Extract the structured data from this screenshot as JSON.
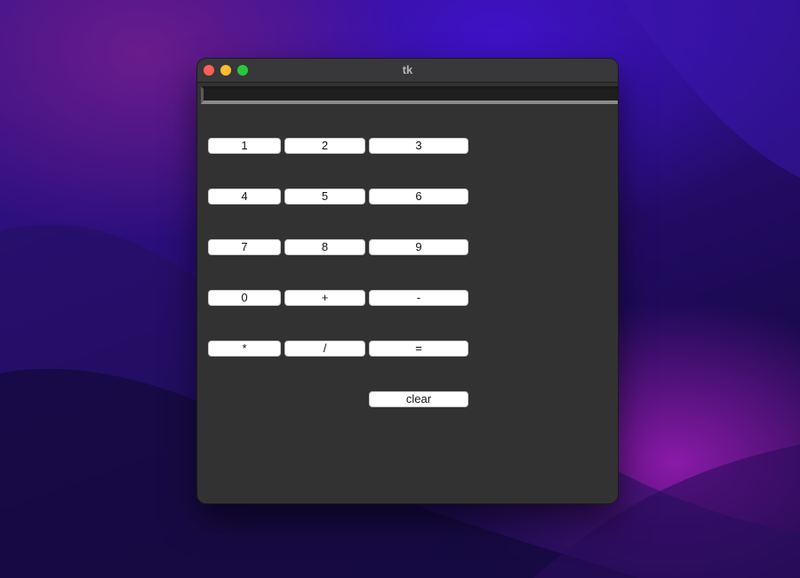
{
  "window": {
    "title": "tk"
  },
  "display": {
    "value": ""
  },
  "keys": {
    "k1": "1",
    "k2": "2",
    "k3": "3",
    "k4": "4",
    "k5": "5",
    "k6": "6",
    "k7": "7",
    "k8": "8",
    "k9": "9",
    "k0": "0",
    "plus": "+",
    "minus": "-",
    "multiply": "*",
    "divide": "/",
    "equals": "=",
    "clear": "clear"
  },
  "colors": {
    "window_bg": "#323232",
    "button_bg": "#ffffff",
    "close": "#fe5f57",
    "minimize": "#febc2e",
    "zoom": "#28c840"
  }
}
